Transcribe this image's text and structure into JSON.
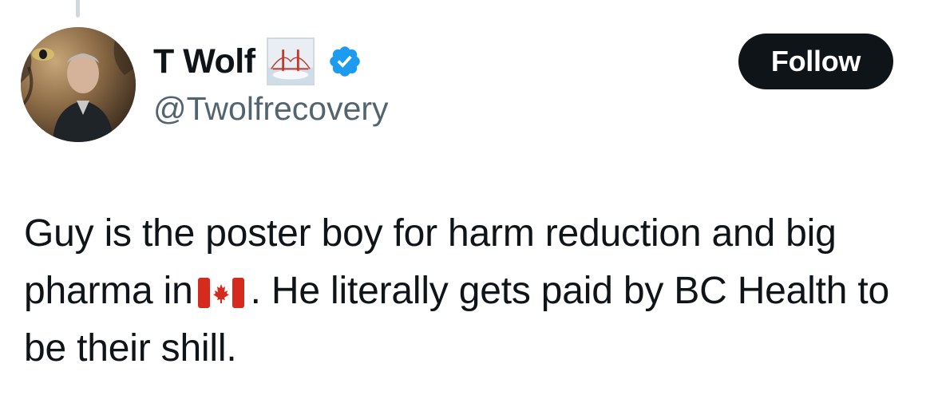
{
  "author": {
    "display_name": "T Wolf",
    "handle": "@Twolfrecovery",
    "verified": true,
    "verified_badge_color": "#1d9bf0",
    "affiliate_badge_icon": "bridge-logo-icon",
    "avatar_icon": "profile-photo"
  },
  "follow_button": {
    "label": "Follow",
    "background": "#0f1419"
  },
  "tweet": {
    "text_before_flag": "Guy is the poster boy for harm reduction and big pharma in",
    "flag_icon": "canada-flag-icon",
    "text_after_flag": ". He literally gets paid by BC Health to be their shill."
  }
}
